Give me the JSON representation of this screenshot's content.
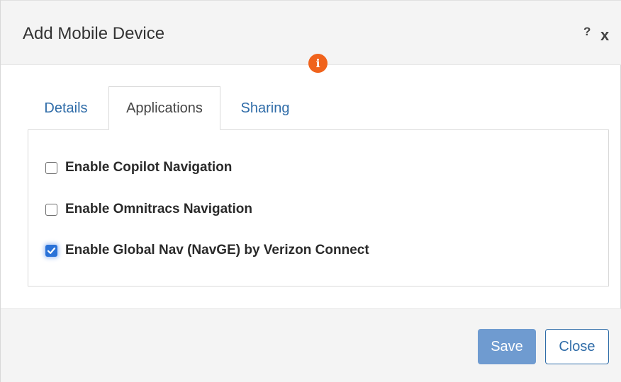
{
  "dialog": {
    "title": "Add Mobile Device",
    "help_label": "?",
    "close_label": "x",
    "info_badge": "i"
  },
  "tabs": [
    {
      "label": "Details",
      "active": false
    },
    {
      "label": "Applications",
      "active": true
    },
    {
      "label": "Sharing",
      "active": false
    }
  ],
  "options": [
    {
      "label": "Enable Copilot Navigation",
      "checked": false
    },
    {
      "label": "Enable Omnitracs Navigation",
      "checked": false
    },
    {
      "label": "Enable Global Nav (NavGE) by Verizon Connect",
      "checked": true
    }
  ],
  "footer": {
    "save_label": "Save",
    "close_label": "Close"
  },
  "colors": {
    "accent": "#2f6ca8",
    "save_button": "#6f9bd0",
    "info_badge": "#f0631c",
    "checkbox_checked": "#2a72d8"
  }
}
